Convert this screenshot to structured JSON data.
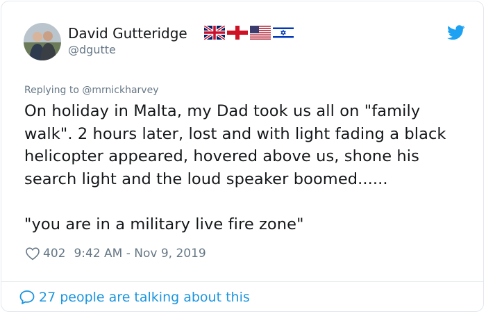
{
  "user": {
    "display_name": "David Gutteridge",
    "handle": "@dgutte",
    "flags": [
      "uk-flag-icon",
      "england-flag-icon",
      "usa-flag-icon",
      "israel-flag-icon"
    ]
  },
  "tweet": {
    "reply_to": "Replying to @mrnickharvey",
    "text": "On holiday in Malta, my Dad took us all on \"family walk\". 2 hours later, lost and with light fading a black helicopter appeared, hovered above us, shone his search light and the loud speaker boomed......\n\n\"you are in a military live fire zone\"",
    "like_count": "402",
    "timestamp": "9:42 AM - Nov 9, 2019"
  },
  "footer": {
    "talking_text": "27 people are talking about this"
  },
  "colors": {
    "twitter_blue": "#1da1f2",
    "link_blue": "#1b95e0",
    "muted_gray": "#657786",
    "border": "#e1e8ed"
  }
}
